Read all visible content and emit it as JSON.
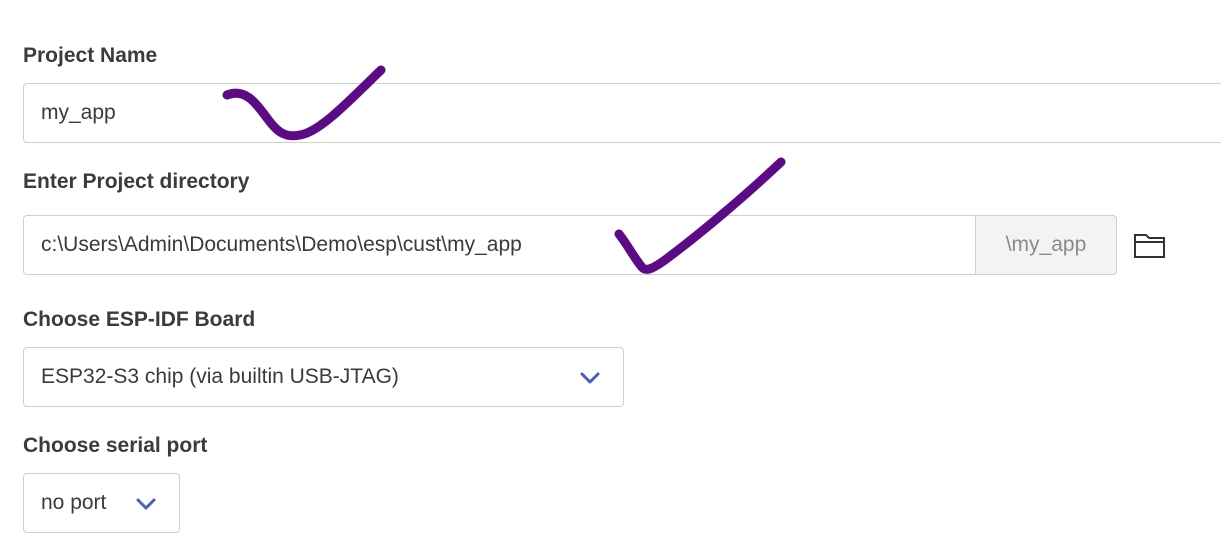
{
  "project_name": {
    "label": "Project Name",
    "value": "my_app"
  },
  "project_directory": {
    "label": "Enter Project directory",
    "value": "c:\\Users\\Admin\\Documents\\Demo\\esp\\cust\\my_app",
    "suffix": "\\my_app",
    "browse_icon": "folder-icon"
  },
  "board": {
    "label": "Choose ESP-IDF Board",
    "selected": "ESP32-S3 chip (via builtin USB-JTAG)",
    "icon": "chevron-down-icon"
  },
  "serial_port": {
    "label": "Choose serial port",
    "selected": "no port",
    "icon": "chevron-down-icon"
  },
  "annotations": {
    "check_color": "#5c0a86",
    "chevron_color": "#4a5fc1"
  }
}
